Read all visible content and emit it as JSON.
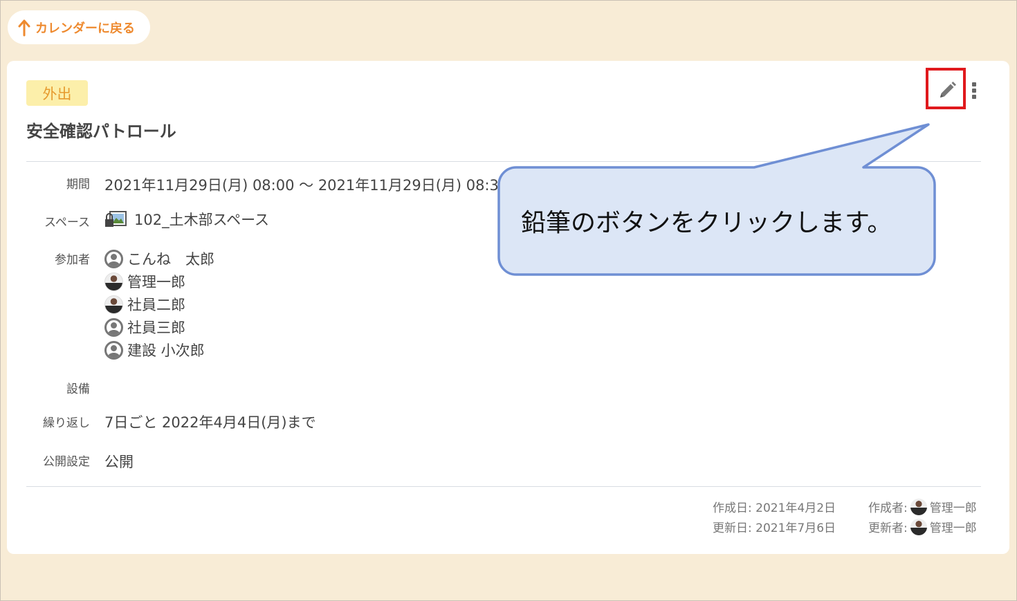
{
  "back_button": {
    "label": "カレンダーに戻る"
  },
  "event": {
    "tag": "外出",
    "title": "安全確認パトロール"
  },
  "details": {
    "period": {
      "label": "期間",
      "value": "2021年11月29日(月) 08:00 ～ 2021年11月29日(月) 08:30"
    },
    "space": {
      "label": "スペース",
      "value": "102_土木部スペース"
    },
    "participants": {
      "label": "参加者",
      "items": [
        {
          "name": "こんね　太郎",
          "avatar": "default"
        },
        {
          "name": "管理一郎",
          "avatar": "photo"
        },
        {
          "name": "社員二郎",
          "avatar": "photo"
        },
        {
          "name": "社員三郎",
          "avatar": "default"
        },
        {
          "name": "建設 小次郎",
          "avatar": "default"
        }
      ]
    },
    "equipment": {
      "label": "設備",
      "value": ""
    },
    "repeat": {
      "label": "繰り返し",
      "value": "7日ごと 2022年4月4日(月)まで"
    },
    "visibility": {
      "label": "公開設定",
      "value": "公開"
    }
  },
  "footer": {
    "created_date": "作成日:  2021年4月2日",
    "updated_date": "更新日:  2021年7月6日",
    "created_by_label": "作成者:",
    "created_by": "管理一郎",
    "updated_by_label": "更新者:",
    "updated_by": "管理一郎"
  },
  "callout": {
    "text": "鉛筆のボタンをクリックします。"
  },
  "colors": {
    "background": "#f8ecd6",
    "accent_orange": "#ee8a2f",
    "tag_bg": "#fcefaa",
    "highlight_red": "#e0191d",
    "callout_fill": "#dce6f6",
    "callout_stroke": "#6f8fd4"
  },
  "icons": {
    "back": "arrow-up-icon",
    "edit": "pencil-icon",
    "more": "more-vertical-icon",
    "space": "space-image-lock-icon",
    "user": "user-avatar-icon"
  }
}
